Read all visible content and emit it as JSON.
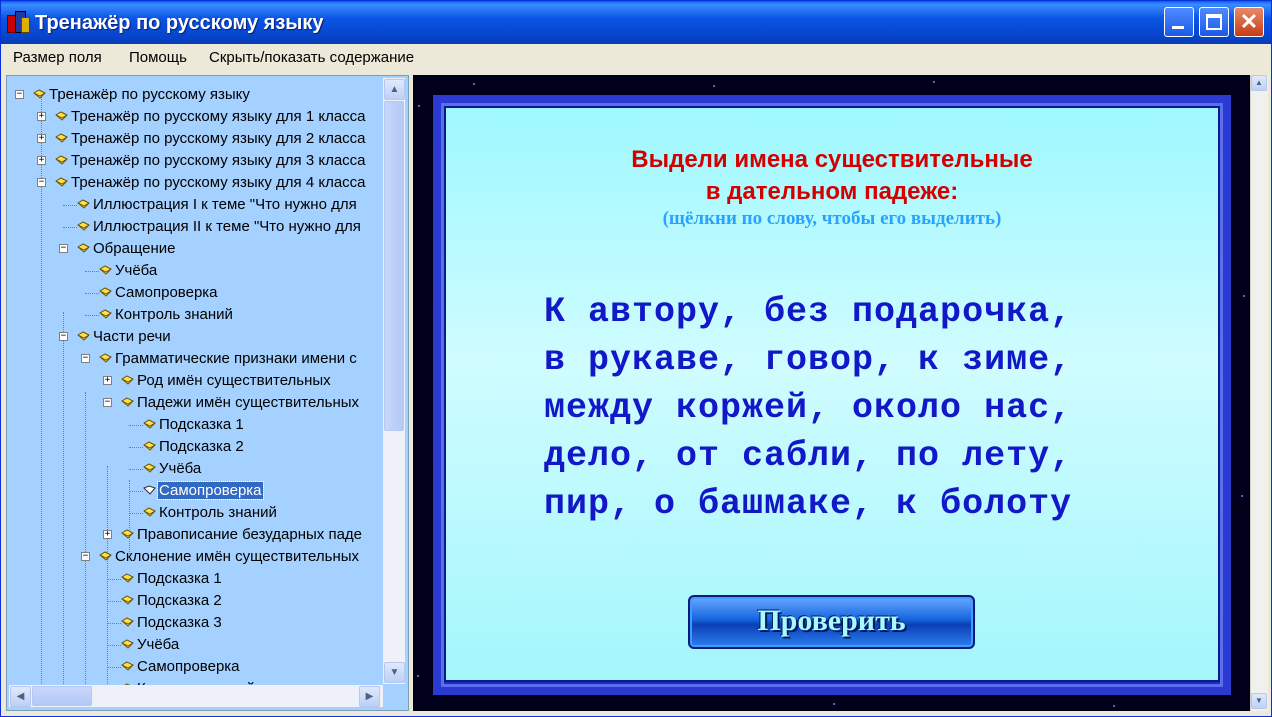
{
  "window": {
    "title": "Тренажёр по русскому языку",
    "min_icon": "minimize-icon",
    "max_icon": "maximize-icon",
    "close_icon": "close-icon",
    "close_glyph": "✕"
  },
  "menu": {
    "items": [
      "Размер поля",
      "Помощь",
      "Скрыть/показать содержание"
    ]
  },
  "tree": {
    "items": [
      {
        "label": "Тренажёр по русскому языку",
        "expander": "−"
      },
      {
        "label": "Тренажёр по русскому языку для 1 класса",
        "expander": "+"
      },
      {
        "label": "Тренажёр по русскому языку для 2 класса",
        "expander": "+"
      },
      {
        "label": "Тренажёр по русскому языку для 3 класса",
        "expander": "+"
      },
      {
        "label": "Тренажёр по русскому языку для 4 класса",
        "expander": "−"
      },
      {
        "label": "Иллюстрация I к теме \"Что нужно для",
        "expander": ""
      },
      {
        "label": "Иллюстрация II к теме \"Что нужно для",
        "expander": ""
      },
      {
        "label": "Обращение",
        "expander": "−"
      },
      {
        "label": "Учёба",
        "expander": ""
      },
      {
        "label": "Самопроверка",
        "expander": ""
      },
      {
        "label": "Контроль знаний",
        "expander": ""
      },
      {
        "label": "Части речи",
        "expander": "−"
      },
      {
        "label": "Грамматические признаки имени с",
        "expander": "−"
      },
      {
        "label": "Род имён существительных",
        "expander": "+"
      },
      {
        "label": "Падежи имён существительных",
        "expander": "−"
      },
      {
        "label": "Подсказка 1",
        "expander": ""
      },
      {
        "label": "Подсказка 2",
        "expander": ""
      },
      {
        "label": "Учёба",
        "expander": ""
      },
      {
        "label": "Самопроверка",
        "expander": "",
        "selected": true
      },
      {
        "label": "Контроль знаний",
        "expander": ""
      },
      {
        "label": "Правописание безударных паде",
        "expander": "+"
      },
      {
        "label": "Склонение имён существительных",
        "expander": "−"
      },
      {
        "label": "Подсказка 1",
        "expander": ""
      },
      {
        "label": "Подсказка 2",
        "expander": ""
      },
      {
        "label": "Подсказка 3",
        "expander": ""
      },
      {
        "label": "Учёба",
        "expander": ""
      },
      {
        "label": "Самопроверка",
        "expander": ""
      },
      {
        "label": "Контроль знаний",
        "expander": ""
      }
    ],
    "node_icon": "book-icon",
    "scroll_up_glyph": "▲",
    "scroll_down_glyph": "▼",
    "scroll_left_glyph": "◀",
    "scroll_right_glyph": "▶"
  },
  "task": {
    "title_line1": "Выдели имена существительные",
    "title_line2": "в дательном падеже:",
    "hint": "(щёлкни по слову, чтобы его выделить)",
    "phrases": [
      "К автору, без подарочка,",
      "в рукаве, говор, к зиме,",
      "между коржей, около нас,",
      "дело, от сабли, по лету,",
      "пир, о башмаке, к болоту"
    ],
    "check_label": "Проверить",
    "title_color": "#d40000",
    "hint_color": "#2aa2ff",
    "text_color": "#1218c8"
  },
  "content_scroll": {
    "up_glyph": "▲",
    "down_glyph": "▼"
  }
}
